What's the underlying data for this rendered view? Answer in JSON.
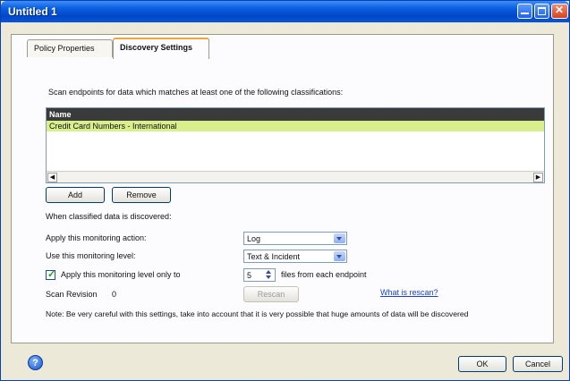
{
  "window": {
    "title": "Untitled 1"
  },
  "tabs": [
    {
      "label": "Policy Properties",
      "active": false
    },
    {
      "label": "Discovery Settings",
      "active": true
    }
  ],
  "scan_intro": "Scan endpoints for data which matches at least one of the following classifications:",
  "classification_list": {
    "column_header": "Name",
    "rows": [
      "Credit Card Numbers - International"
    ]
  },
  "buttons": {
    "add": "Add",
    "remove": "Remove",
    "rescan": "Rescan",
    "ok": "OK",
    "cancel": "Cancel"
  },
  "discovered_label": "When classified data is discovered:",
  "monitoring_action": {
    "label": "Apply this monitoring action:",
    "value": "Log"
  },
  "monitoring_level": {
    "label": "Use this monitoring level:",
    "value": "Text & Incident"
  },
  "limit_files": {
    "label": "Apply this monitoring level only to",
    "checked": true,
    "value": "5",
    "suffix": "files from each endpoint"
  },
  "scan_revision": {
    "label": "Scan Revision",
    "value": "0"
  },
  "rescan_link": "What is rescan?",
  "note": "Note: Be very careful with this settings, take into account that it is very possible that huge amounts of data will be discovered",
  "colors": {
    "titlebar": "#0a55d8",
    "selected_row": "#d9ef8b",
    "header_row": "#3a3a3a",
    "link": "#1a3fd8",
    "active_tab_accent": "#f4a536"
  },
  "icons": {
    "help": "help-icon"
  }
}
